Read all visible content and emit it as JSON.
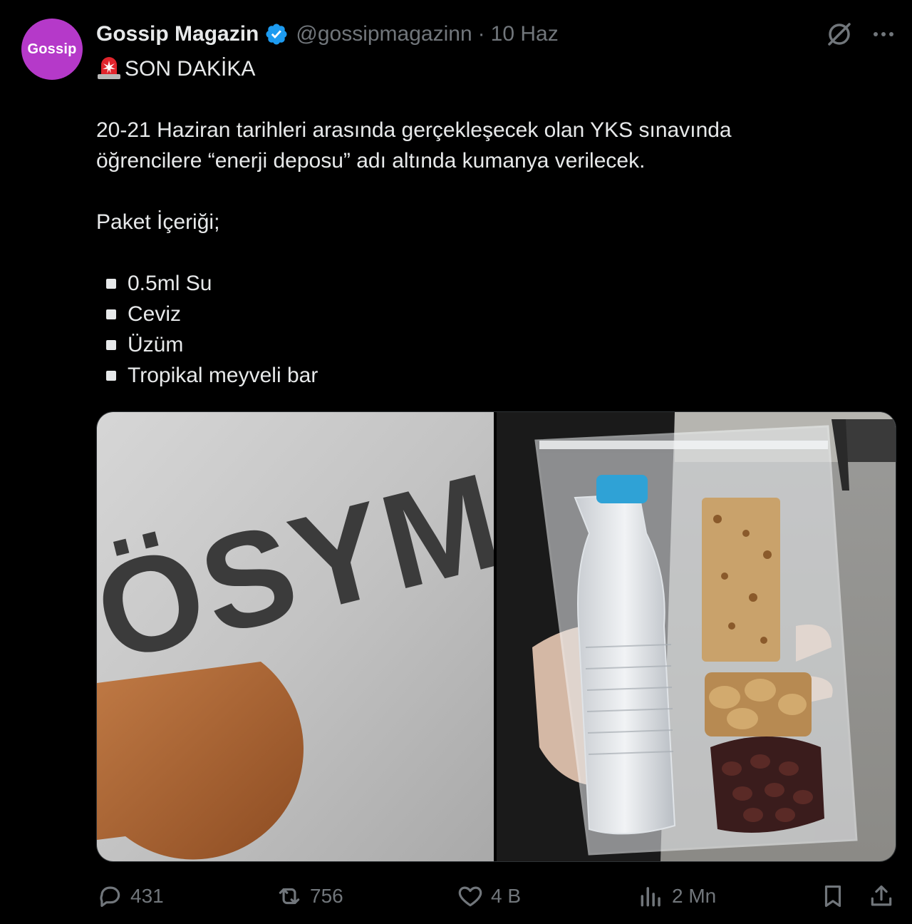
{
  "author": {
    "avatar_text": "Gossip",
    "display_name": "Gossip Magazin",
    "handle": "@gossipmagazinn",
    "separator": "·",
    "date": "10 Haz"
  },
  "icons": {
    "grok": "grok-icon",
    "more": "more-icon",
    "verified": "verified-badge-icon",
    "siren": "rotating-light-emoji"
  },
  "tweet": {
    "headline": "SON DAKİKA",
    "paragraph_line1": "20-21 Haziran tarihleri arasında gerçekleşecek olan YKS sınavında",
    "paragraph_line2": "öğrencilere “enerji deposu” adı altında kumanya verilecek.",
    "package_title": "Paket İçeriği;",
    "items": [
      "0.5ml Su",
      "Ceviz",
      "Üzüm",
      "Tropikal meyveli bar"
    ]
  },
  "media": {
    "left_logo_text": "ÖSYM"
  },
  "actions": {
    "replies": "431",
    "reposts": "756",
    "likes": "4 B",
    "views": "2 Mn"
  },
  "colors": {
    "background": "#000000",
    "text": "#e7e9ea",
    "muted": "#71767b",
    "verified": "#1d9bf0",
    "avatar": "#b539c9"
  }
}
